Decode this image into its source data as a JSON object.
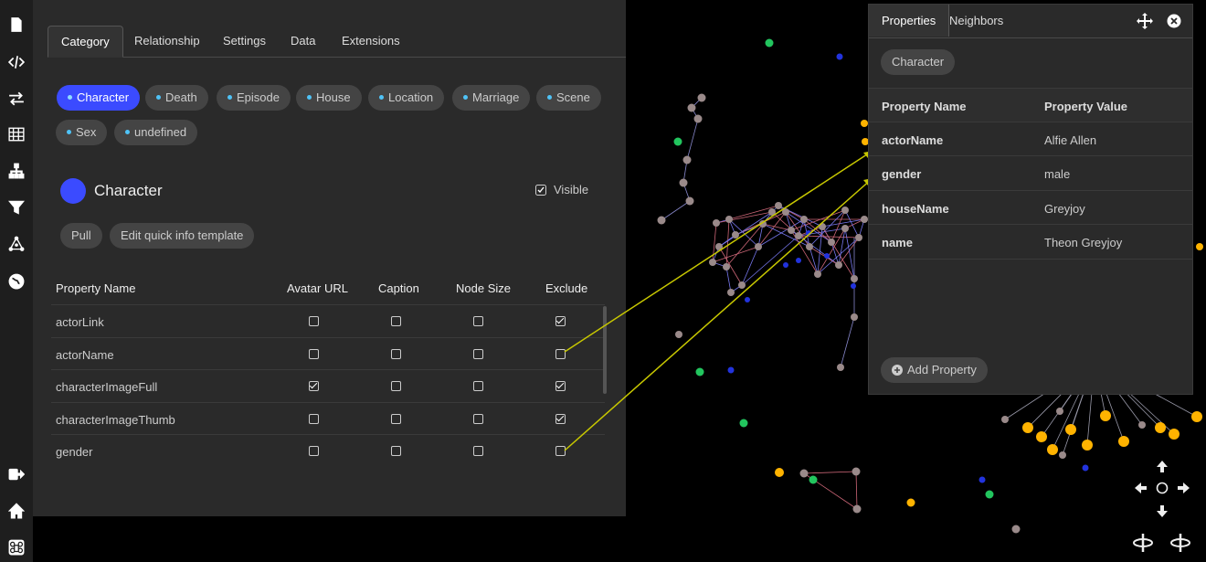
{
  "sidebar": {
    "icons": [
      "file-icon",
      "code-icon",
      "swap-icon",
      "table-icon",
      "hierarchy-icon",
      "filter-icon",
      "network-icon",
      "globe-icon",
      "logout-icon",
      "home-icon",
      "command-icon"
    ]
  },
  "panel": {
    "tabs": [
      "Category",
      "Relationship",
      "Settings",
      "Data",
      "Extensions"
    ],
    "chips": [
      "Character",
      "Death",
      "Episode",
      "House",
      "Location",
      "Marriage",
      "Scene",
      "Sex",
      "undefined"
    ],
    "category_title": "Character",
    "category_color": "#3b4bff",
    "visible_label": "Visible",
    "pull_label": "Pull",
    "edit_label": "Edit quick info template",
    "table_headers": [
      "Property Name",
      "Avatar URL",
      "Caption",
      "Node Size",
      "Exclude"
    ],
    "rows": [
      {
        "name": "actorLink",
        "avatar": false,
        "caption": false,
        "size": false,
        "exclude": true
      },
      {
        "name": "actorName",
        "avatar": false,
        "caption": false,
        "size": false,
        "exclude": false
      },
      {
        "name": "characterImageFull",
        "avatar": true,
        "caption": false,
        "size": false,
        "exclude": true
      },
      {
        "name": "characterImageThumb",
        "avatar": false,
        "caption": false,
        "size": false,
        "exclude": true
      },
      {
        "name": "gender",
        "avatar": false,
        "caption": false,
        "size": false,
        "exclude": false
      }
    ]
  },
  "props": {
    "tabs": [
      "Properties",
      "Neighbors"
    ],
    "chip": "Character",
    "header_name": "Property Name",
    "header_value": "Property Value",
    "rows": [
      {
        "k": "actorName",
        "v": "Alfie Allen"
      },
      {
        "k": "gender",
        "v": "male"
      },
      {
        "k": "houseName",
        "v": "Greyjoy"
      },
      {
        "k": "name",
        "v": "Theon Greyjoy"
      }
    ],
    "add_label": "Add Property"
  },
  "colors": {
    "accent": "#3b4bff",
    "node_gray": "#9a8a8a",
    "node_orange": "#ffb300",
    "node_green": "#22c55e",
    "node_blue": "#2233dd",
    "annotation_line": "#c8c800"
  }
}
